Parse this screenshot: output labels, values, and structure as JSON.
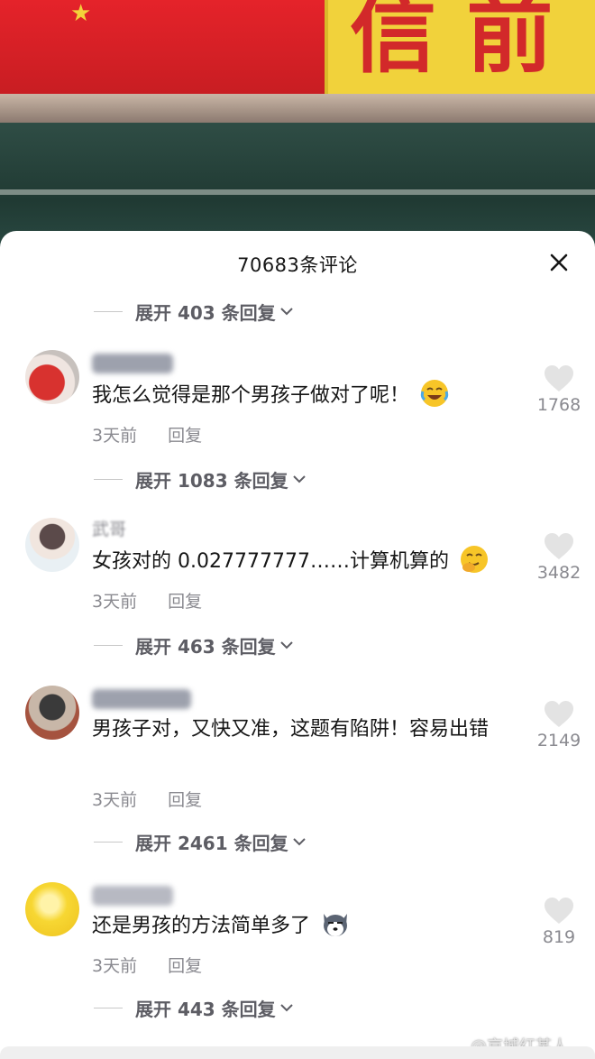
{
  "background": {
    "banner_text": "信 前"
  },
  "sheet": {
    "title": "70683条评论",
    "close_icon": "close-icon"
  },
  "top_expand": {
    "label": "展开 403 条回复"
  },
  "comments": [
    {
      "text": "我怎么觉得是那个男孩子做对了呢！",
      "emoji": "rofl-emoji",
      "time": "3天前",
      "reply": "回复",
      "likes": "1768",
      "expand": "展开 1083 条回复"
    },
    {
      "username": "武哥",
      "text": "女孩对的 0.027777777……计算机算的",
      "emoji": "giggle-emoji",
      "time": "3天前",
      "reply": "回复",
      "likes": "3482",
      "expand": "展开 463 条回复"
    },
    {
      "text": "男孩子对，又快又准，这题有陷阱！容易出错",
      "time": "3天前",
      "reply": "回复",
      "likes": "2149",
      "expand": "展开 2461 条回复"
    },
    {
      "text": "还是男孩的方法简单多了",
      "emoji": "husky-emoji",
      "time": "3天前",
      "reply": "回复",
      "likes": "819",
      "expand": "展开 443 条回复"
    }
  ],
  "watermark": "@京城红某人",
  "colors": {
    "text": "#161616",
    "muted": "#8a8a90",
    "like_icon": "#e3e3e3"
  }
}
